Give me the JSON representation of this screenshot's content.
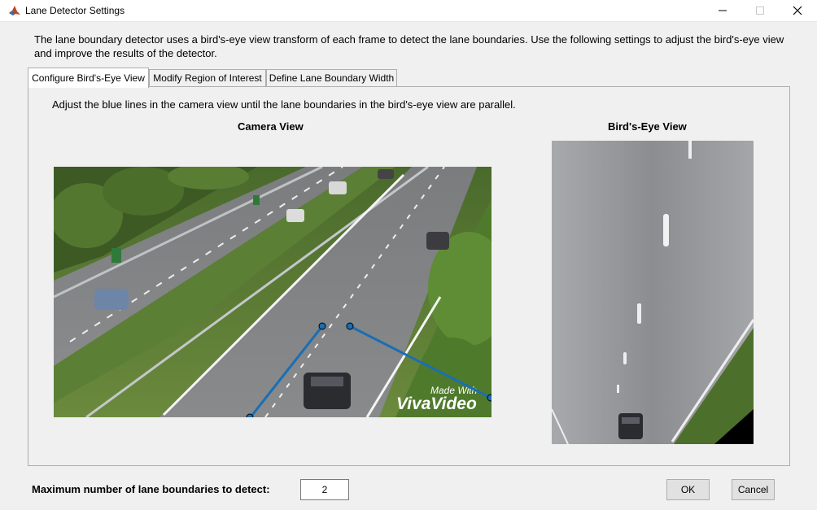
{
  "window": {
    "title": "Lane Detector Settings"
  },
  "description": "The lane boundary detector uses a bird's-eye view transform of each frame to detect the lane boundaries. Use the following settings to adjust the bird's-eye view and improve the results of the detector.",
  "tabs": [
    {
      "label": "Configure Bird's-Eye View",
      "active": true
    },
    {
      "label": "Modify Region of Interest",
      "active": false
    },
    {
      "label": "Define Lane Boundary Width",
      "active": false
    }
  ],
  "panel": {
    "instruction": "Adjust the blue lines in the camera view until the lane boundaries in the bird's-eye view are parallel.",
    "camera_view_title": "Camera View",
    "birds_eye_title": "Bird's-Eye View",
    "watermark_line1": "Made With",
    "watermark_line2": "VivaVideo"
  },
  "footer": {
    "max_boundaries_label": "Maximum number of lane boundaries to detect:",
    "max_boundaries_value": "2",
    "ok_label": "OK",
    "cancel_label": "Cancel"
  },
  "colors": {
    "handle_line": "#1a6eb5",
    "window_bg": "#f0f0f0"
  }
}
